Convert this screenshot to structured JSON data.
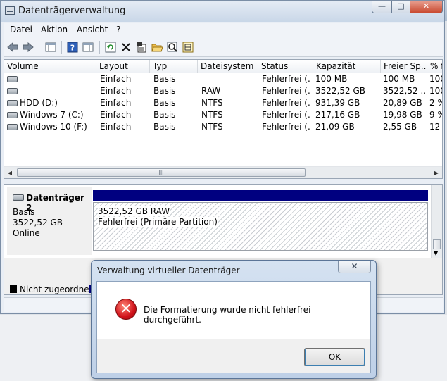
{
  "window": {
    "title": "Datenträgerverwaltung",
    "controls": {
      "minimize": "—",
      "maximize": "□",
      "close": "✕"
    }
  },
  "menu": [
    "Datei",
    "Aktion",
    "Ansicht",
    "?"
  ],
  "toolbar": {
    "icons": [
      "back-arrow-icon",
      "forward-arrow-icon",
      "console-tree-icon",
      "help-icon",
      "properties-pane-icon",
      "refresh-icon",
      "delete-icon",
      "properties-icon",
      "open-folder-icon",
      "explore-icon",
      "rescan-icon"
    ]
  },
  "volume_table": {
    "columns": [
      "Volume",
      "Layout",
      "Typ",
      "Dateisystem",
      "Status",
      "Kapazität",
      "Freier Sp...",
      "% f"
    ],
    "rows": [
      {
        "volume": "",
        "layout": "Einfach",
        "typ": "Basis",
        "fs": "",
        "status": "Fehlerfrei (...",
        "kap": "100 MB",
        "frei": "100 MB",
        "pct": "100"
      },
      {
        "volume": "",
        "layout": "Einfach",
        "typ": "Basis",
        "fs": "RAW",
        "status": "Fehlerfrei (...",
        "kap": "3522,52 GB",
        "frei": "3522,52 ...",
        "pct": "100"
      },
      {
        "volume": "HDD (D:)",
        "layout": "Einfach",
        "typ": "Basis",
        "fs": "NTFS",
        "status": "Fehlerfrei (...",
        "kap": "931,39 GB",
        "frei": "20,89 GB",
        "pct": "2 %"
      },
      {
        "volume": "Windows 7 (C:)",
        "layout": "Einfach",
        "typ": "Basis",
        "fs": "NTFS",
        "status": "Fehlerfrei (...",
        "kap": "217,16 GB",
        "frei": "19,98 GB",
        "pct": "9 %"
      },
      {
        "volume": "Windows 10 (F:)",
        "layout": "Einfach",
        "typ": "Basis",
        "fs": "NTFS",
        "status": "Fehlerfrei (...",
        "kap": "21,09 GB",
        "frei": "2,55 GB",
        "pct": "12"
      }
    ],
    "scroll_grip": "III"
  },
  "disk": {
    "name": "Datenträger 2",
    "type": "Basis",
    "size": "3522,52 GB",
    "state": "Online",
    "partition": {
      "line1": "3522,52 GB RAW",
      "line2": "Fehlerfrei (Primäre Partition)"
    }
  },
  "legend": {
    "unallocated": "Nicht zugeordnet"
  },
  "dialog": {
    "title": "Verwaltung virtueller Datenträger",
    "close": "✕",
    "message": "Die Formatierung wurde nicht fehlerfrei durchgeführt.",
    "ok": "OK"
  }
}
